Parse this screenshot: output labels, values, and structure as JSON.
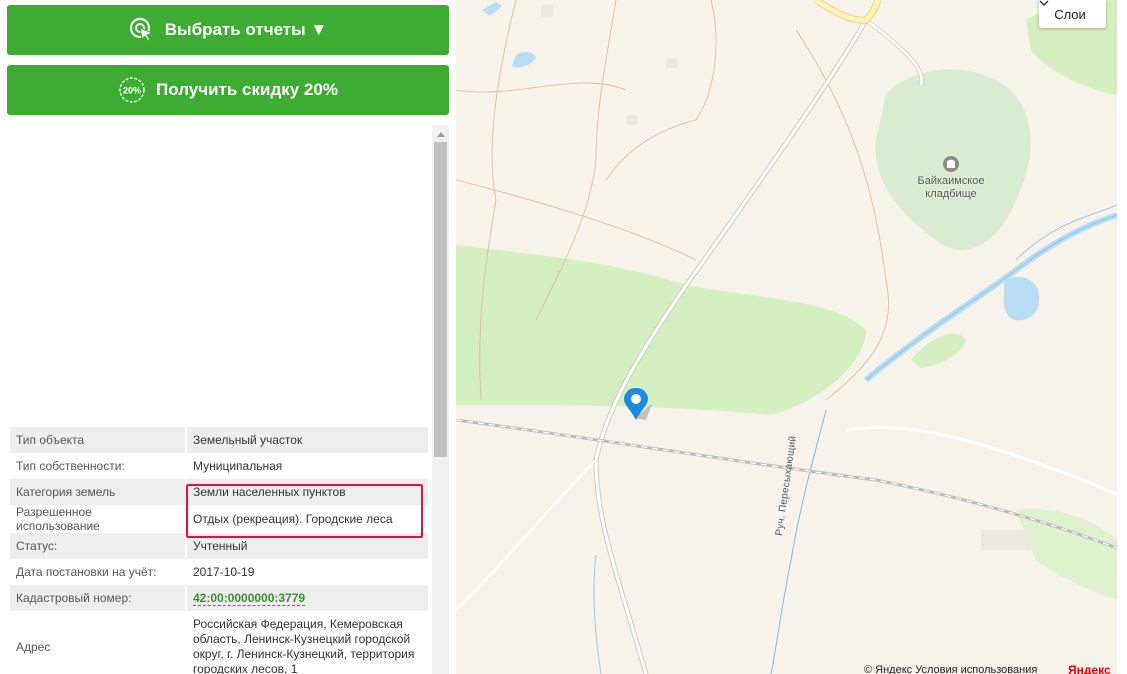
{
  "buttons": {
    "reports_label": "Выбрать отчеты ▼",
    "discount_label": "Получить скидку 20%",
    "discount_icon_text": "20%"
  },
  "info_rows": [
    {
      "key": "Тип объекта",
      "value": "Земельный участок"
    },
    {
      "key": "Тип собственности:",
      "value": "Муниципальная"
    },
    {
      "key": "Категория земель",
      "value": "Земли населенных пунктов"
    },
    {
      "key": "Разрешенное использование",
      "value": "Отдых (рекреация). Городские леса"
    },
    {
      "key": "Статус:",
      "value": "Учтенный"
    },
    {
      "key": "Дата постановки на учёт:",
      "value": "2017-10-19"
    },
    {
      "key": "Кадастровый номер:",
      "value": "42:00:0000000:3779"
    },
    {
      "key": "Адрес",
      "value": "Российская Федерация, Кемеровская область, Ленинск-Кузнецкий городской округ, г. Ленинск-Кузнецкий, территория городских лесов, 1"
    }
  ],
  "map": {
    "layers_label": "Слои",
    "cemetery_line1": "Байкаимское",
    "cemetery_line2": "кладбище",
    "stream_label": "Руч. Пересыхающий",
    "copyright": "© Яндекс Условия использования",
    "logo": "Яндекс"
  },
  "colors": {
    "button_green": "#3eab33",
    "highlight": "#e0104a",
    "forest": "#d4efc0",
    "link": "#3b8f2f",
    "marker": "#1e88e5"
  }
}
